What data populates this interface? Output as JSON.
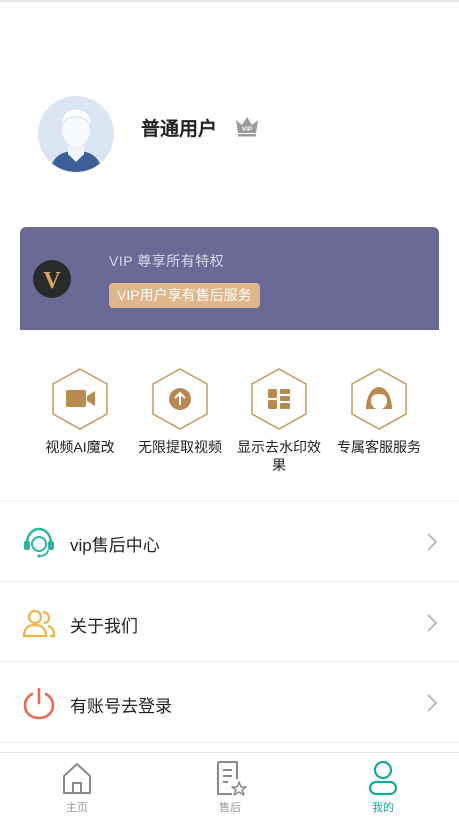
{
  "profile": {
    "username": "普通用户",
    "vip_badge": "VIP"
  },
  "vip_banner": {
    "logo_letter": "V",
    "title": "VIP 尊享所有特权",
    "subtitle": "VIP用户享有售后服务",
    "colors": {
      "background": "#6b6a96",
      "pill": "#e0b68a",
      "accent": "#c49a5f"
    }
  },
  "features": [
    {
      "label": "视频AI魔改",
      "icon": "video-camera-icon"
    },
    {
      "label": "无限提取视频",
      "icon": "upload-arrow-icon"
    },
    {
      "label": "显示去水印效果",
      "icon": "grid-apps-icon"
    },
    {
      "label": "专属客服服务",
      "icon": "support-agent-icon"
    }
  ],
  "menu": [
    {
      "label": "vip售后中心",
      "icon": "headset-icon",
      "color": "#2bb3a3"
    },
    {
      "label": "关于我们",
      "icon": "users-icon",
      "color": "#f0b444"
    },
    {
      "label": "有账号去登录",
      "icon": "power-icon",
      "color": "#e86b5a"
    }
  ],
  "bottom_nav": [
    {
      "label": "主页",
      "icon": "home-icon",
      "active": false
    },
    {
      "label": "售后",
      "icon": "document-star-icon",
      "active": false
    },
    {
      "label": "我的",
      "icon": "person-icon",
      "active": true
    }
  ],
  "colors": {
    "active": "#17a89a",
    "inactive": "#9a9a9a",
    "hex_stroke": "#c49a5f"
  }
}
